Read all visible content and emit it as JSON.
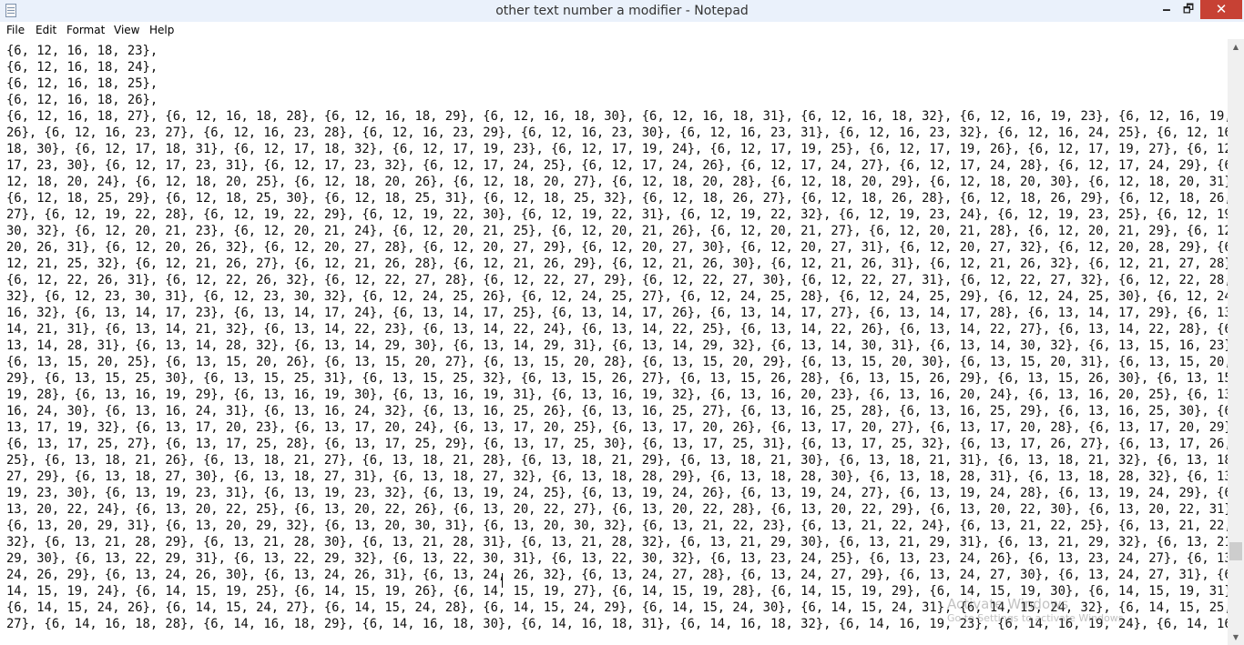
{
  "window": {
    "title": "other text number  a modifier - Notepad",
    "minimize": "🗕",
    "maximize": "🗗",
    "close": "✕"
  },
  "menu": {
    "file": "File",
    "edit": "Edit",
    "format": "Format",
    "view": "View",
    "help": "Help"
  },
  "editor": {
    "text": "{6, 12, 16, 18, 23},\n{6, 12, 16, 18, 24},\n{6, 12, 16, 18, 25},\n{6, 12, 16, 18, 26},\n{6, 12, 16, 18, 27}, {6, 12, 16, 18, 28}, {6, 12, 16, 18, 29}, {6, 12, 16, 18, 30}, {6, 12, 16, 18, 31}, {6, 12, 16, 18, 32}, {6, 12, 16, 19, 23}, {6, 12, 16, 19, 24},\n26}, {6, 12, 16, 23, 27}, {6, 12, 16, 23, 28}, {6, 12, 16, 23, 29}, {6, 12, 16, 23, 30}, {6, 12, 16, 23, 31}, {6, 12, 16, 23, 32}, {6, 12, 16, 24, 25}, {6, 12, 16, 24,\n18, 30}, {6, 12, 17, 18, 31}, {6, 12, 17, 18, 32}, {6, 12, 17, 19, 23}, {6, 12, 17, 19, 24}, {6, 12, 17, 19, 25}, {6, 12, 17, 19, 26}, {6, 12, 17, 19, 27}, {6, 12, 17,\n17, 23, 30}, {6, 12, 17, 23, 31}, {6, 12, 17, 23, 32}, {6, 12, 17, 24, 25}, {6, 12, 17, 24, 26}, {6, 12, 17, 24, 27}, {6, 12, 17, 24, 28}, {6, 12, 17, 24, 29}, {6, 12,\n12, 18, 20, 24}, {6, 12, 18, 20, 25}, {6, 12, 18, 20, 26}, {6, 12, 18, 20, 27}, {6, 12, 18, 20, 28}, {6, 12, 18, 20, 29}, {6, 12, 18, 20, 30}, {6, 12, 18, 20, 31}, {6,\n{6, 12, 18, 25, 29}, {6, 12, 18, 25, 30}, {6, 12, 18, 25, 31}, {6, 12, 18, 25, 32}, {6, 12, 18, 26, 27}, {6, 12, 18, 26, 28}, {6, 12, 18, 26, 29}, {6, 12, 18, 26, 30},\n27}, {6, 12, 19, 22, 28}, {6, 12, 19, 22, 29}, {6, 12, 19, 22, 30}, {6, 12, 19, 22, 31}, {6, 12, 19, 22, 32}, {6, 12, 19, 23, 24}, {6, 12, 19, 23, 25}, {6, 12, 19, 23,\n30, 32}, {6, 12, 20, 21, 23}, {6, 12, 20, 21, 24}, {6, 12, 20, 21, 25}, {6, 12, 20, 21, 26}, {6, 12, 20, 21, 27}, {6, 12, 20, 21, 28}, {6, 12, 20, 21, 29}, {6, 12, 20,\n20, 26, 31}, {6, 12, 20, 26, 32}, {6, 12, 20, 27, 28}, {6, 12, 20, 27, 29}, {6, 12, 20, 27, 30}, {6, 12, 20, 27, 31}, {6, 12, 20, 27, 32}, {6, 12, 20, 28, 29}, {6, 12,\n12, 21, 25, 32}, {6, 12, 21, 26, 27}, {6, 12, 21, 26, 28}, {6, 12, 21, 26, 29}, {6, 12, 21, 26, 30}, {6, 12, 21, 26, 31}, {6, 12, 21, 26, 32}, {6, 12, 21, 27, 28}, {6,\n{6, 12, 22, 26, 31}, {6, 12, 22, 26, 32}, {6, 12, 22, 27, 28}, {6, 12, 22, 27, 29}, {6, 12, 22, 27, 30}, {6, 12, 22, 27, 31}, {6, 12, 22, 27, 32}, {6, 12, 22, 28, 29},\n32}, {6, 12, 23, 30, 31}, {6, 12, 23, 30, 32}, {6, 12, 24, 25, 26}, {6, 12, 24, 25, 27}, {6, 12, 24, 25, 28}, {6, 12, 24, 25, 29}, {6, 12, 24, 25, 30}, {6, 12, 24, 25,\n16, 32}, {6, 13, 14, 17, 23}, {6, 13, 14, 17, 24}, {6, 13, 14, 17, 25}, {6, 13, 14, 17, 26}, {6, 13, 14, 17, 27}, {6, 13, 14, 17, 28}, {6, 13, 14, 17, 29}, {6, 13, 14,\n14, 21, 31}, {6, 13, 14, 21, 32}, {6, 13, 14, 22, 23}, {6, 13, 14, 22, 24}, {6, 13, 14, 22, 25}, {6, 13, 14, 22, 26}, {6, 13, 14, 22, 27}, {6, 13, 14, 22, 28}, {6, 13,\n13, 14, 28, 31}, {6, 13, 14, 28, 32}, {6, 13, 14, 29, 30}, {6, 13, 14, 29, 31}, {6, 13, 14, 29, 32}, {6, 13, 14, 30, 31}, {6, 13, 14, 30, 32}, {6, 13, 15, 16, 23}, {6,\n{6, 13, 15, 20, 25}, {6, 13, 15, 20, 26}, {6, 13, 15, 20, 27}, {6, 13, 15, 20, 28}, {6, 13, 15, 20, 29}, {6, 13, 15, 20, 30}, {6, 13, 15, 20, 31}, {6, 13, 15, 20, 32},\n29}, {6, 13, 15, 25, 30}, {6, 13, 15, 25, 31}, {6, 13, 15, 25, 32}, {6, 13, 15, 26, 27}, {6, 13, 15, 26, 28}, {6, 13, 15, 26, 29}, {6, 13, 15, 26, 30}, {6, 13, 15, 26,\n19, 28}, {6, 13, 16, 19, 29}, {6, 13, 16, 19, 30}, {6, 13, 16, 19, 31}, {6, 13, 16, 19, 32}, {6, 13, 16, 20, 23}, {6, 13, 16, 20, 24}, {6, 13, 16, 20, 25}, {6, 13, 16,\n16, 24, 30}, {6, 13, 16, 24, 31}, {6, 13, 16, 24, 32}, {6, 13, 16, 25, 26}, {6, 13, 16, 25, 27}, {6, 13, 16, 25, 28}, {6, 13, 16, 25, 29}, {6, 13, 16, 25, 30}, {6, 13,\n13, 17, 19, 32}, {6, 13, 17, 20, 23}, {6, 13, 17, 20, 24}, {6, 13, 17, 20, 25}, {6, 13, 17, 20, 26}, {6, 13, 17, 20, 27}, {6, 13, 17, 20, 28}, {6, 13, 17, 20, 29}, {6,\n{6, 13, 17, 25, 27}, {6, 13, 17, 25, 28}, {6, 13, 17, 25, 29}, {6, 13, 17, 25, 30}, {6, 13, 17, 25, 31}, {6, 13, 17, 25, 32}, {6, 13, 17, 26, 27}, {6, 13, 17, 26, 28},\n25}, {6, 13, 18, 21, 26}, {6, 13, 18, 21, 27}, {6, 13, 18, 21, 28}, {6, 13, 18, 21, 29}, {6, 13, 18, 21, 30}, {6, 13, 18, 21, 31}, {6, 13, 18, 21, 32}, {6, 13, 18, 22,\n27, 29}, {6, 13, 18, 27, 30}, {6, 13, 18, 27, 31}, {6, 13, 18, 27, 32}, {6, 13, 18, 28, 29}, {6, 13, 18, 28, 30}, {6, 13, 18, 28, 31}, {6, 13, 18, 28, 32}, {6, 13, 18,\n19, 23, 30}, {6, 13, 19, 23, 31}, {6, 13, 19, 23, 32}, {6, 13, 19, 24, 25}, {6, 13, 19, 24, 26}, {6, 13, 19, 24, 27}, {6, 13, 19, 24, 28}, {6, 13, 19, 24, 29}, {6, 13,\n13, 20, 22, 24}, {6, 13, 20, 22, 25}, {6, 13, 20, 22, 26}, {6, 13, 20, 22, 27}, {6, 13, 20, 22, 28}, {6, 13, 20, 22, 29}, {6, 13, 20, 22, 30}, {6, 13, 20, 22, 31}, {6,\n{6, 13, 20, 29, 31}, {6, 13, 20, 29, 32}, {6, 13, 20, 30, 31}, {6, 13, 20, 30, 32}, {6, 13, 21, 22, 23}, {6, 13, 21, 22, 24}, {6, 13, 21, 22, 25}, {6, 13, 21, 22, 26},\n32}, {6, 13, 21, 28, 29}, {6, 13, 21, 28, 30}, {6, 13, 21, 28, 31}, {6, 13, 21, 28, 32}, {6, 13, 21, 29, 30}, {6, 13, 21, 29, 31}, {6, 13, 21, 29, 32}, {6, 13, 21, 30,\n29, 30}, {6, 13, 22, 29, 31}, {6, 13, 22, 29, 32}, {6, 13, 22, 30, 31}, {6, 13, 22, 30, 32}, {6, 13, 23, 24, 25}, {6, 13, 23, 24, 26}, {6, 13, 23, 24, 27}, {6, 13, 23,\n24, 26, 29}, {6, 13, 24, 26, 30}, {6, 13, 24, 26, 31}, {6, 13, 24, 26, 32}, {6, 13, 24, 27, 28}, {6, 13, 24, 27, 29}, {6, 13, 24, 27, 30}, {6, 13, 24, 27, 31}, {6, 13,\n14, 15, 19, 24}, {6, 14, 15, 19, 25}, {6, 14, 15, 19, 26}, {6, 14, 15, 19, 27}, {6, 14, 15, 19, 28}, {6, 14, 15, 19, 29}, {6, 14, 15, 19, 30}, {6, 14, 15, 19, 31}, {6,\n{6, 14, 15, 24, 26}, {6, 14, 15, 24, 27}, {6, 14, 15, 24, 28}, {6, 14, 15, 24, 29}, {6, 14, 15, 24, 30}, {6, 14, 15, 24, 31}, {6, 14, 15, 24, 32}, {6, 14, 15, 25, 26},\n27}, {6, 14, 16, 18, 28}, {6, 14, 16, 18, 29}, {6, 14, 16, 18, 30}, {6, 14, 16, 18, 31}, {6, 14, 16, 18, 32}, {6, 14, 16, 19, 23}, {6, 14, 16, 19, 24}, {6, 14, 16, 19,"
  },
  "watermark": {
    "line1": "Activate Windows",
    "line2": "Go to Settings to activate Windows."
  }
}
